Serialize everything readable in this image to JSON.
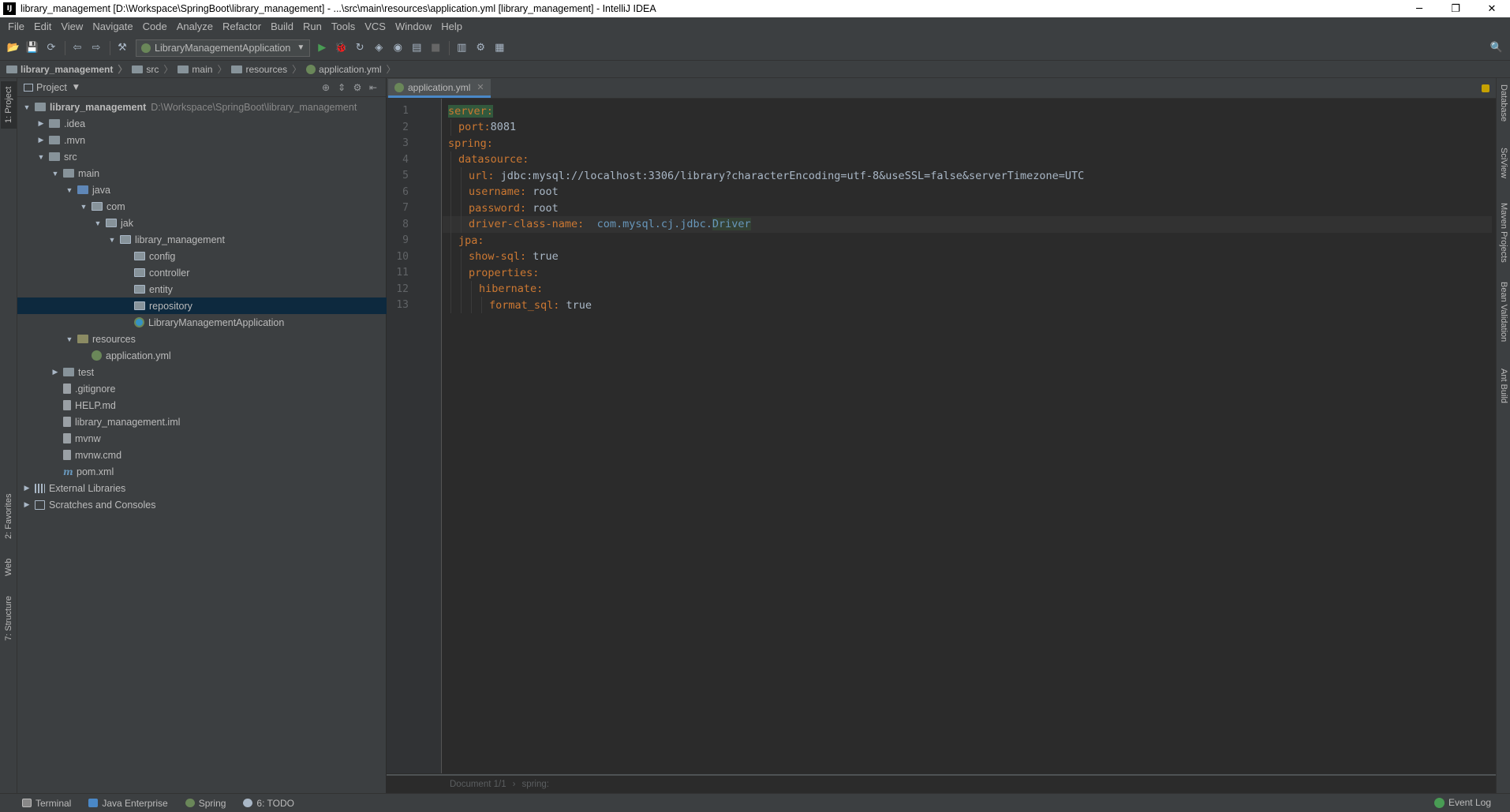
{
  "window": {
    "title": "library_management [D:\\Workspace\\SpringBoot\\library_management] - ...\\src\\main\\resources\\application.yml [library_management] - IntelliJ IDEA",
    "app_icon_text": "IJ",
    "minimize": "─",
    "restore": "❐",
    "close": "✕"
  },
  "menu": [
    "File",
    "Edit",
    "View",
    "Navigate",
    "Code",
    "Analyze",
    "Refactor",
    "Build",
    "Run",
    "Tools",
    "VCS",
    "Window",
    "Help"
  ],
  "toolbar": {
    "run_config": "LibraryManagementApplication",
    "icons": {
      "open": "📂",
      "save": "💾",
      "sync": "⟳",
      "back": "⇦",
      "forward": "⇨",
      "build": "⚒",
      "run": "▶",
      "debug": "🐞",
      "rerun": "↻",
      "coverage": "◈",
      "profile": "◉",
      "stop_all": "▤",
      "stop": "■",
      "structure": "▥",
      "sdk": "⚙",
      "project_structure": "▦",
      "search": "🔍"
    }
  },
  "breadcrumb": [
    "library_management",
    "src",
    "main",
    "resources",
    "application.yml"
  ],
  "left_tabs": {
    "project": "1: Project",
    "favorites": "2: Favorites",
    "web": "Web",
    "structure": "7: Structure"
  },
  "right_tabs": [
    "Database",
    "SciView",
    "Maven Projects",
    "Bean Validation",
    "Ant Build"
  ],
  "project_panel": {
    "title": "Project",
    "tree": [
      {
        "label": "library_management",
        "path": "D:\\Workspace\\SpringBoot\\library_management",
        "depth": 0,
        "arrow": "▼",
        "icon": "folder",
        "bold": true
      },
      {
        "label": ".idea",
        "depth": 1,
        "arrow": "▶",
        "icon": "folder"
      },
      {
        "label": ".mvn",
        "depth": 1,
        "arrow": "▶",
        "icon": "folder"
      },
      {
        "label": "src",
        "depth": 1,
        "arrow": "▼",
        "icon": "folder"
      },
      {
        "label": "main",
        "depth": 2,
        "arrow": "▼",
        "icon": "folder"
      },
      {
        "label": "java",
        "depth": 3,
        "arrow": "▼",
        "icon": "folder-src"
      },
      {
        "label": "com",
        "depth": 4,
        "arrow": "▼",
        "icon": "folder-pkg"
      },
      {
        "label": "jak",
        "depth": 5,
        "arrow": "▼",
        "icon": "folder-pkg"
      },
      {
        "label": "library_management",
        "depth": 6,
        "arrow": "▼",
        "icon": "folder-pkg"
      },
      {
        "label": "config",
        "depth": 7,
        "arrow": "",
        "icon": "folder-pkg"
      },
      {
        "label": "controller",
        "depth": 7,
        "arrow": "",
        "icon": "folder-pkg"
      },
      {
        "label": "entity",
        "depth": 7,
        "arrow": "",
        "icon": "folder-pkg"
      },
      {
        "label": "repository",
        "depth": 7,
        "arrow": "",
        "icon": "folder-pkg",
        "selected": true
      },
      {
        "label": "LibraryManagementApplication",
        "depth": 7,
        "arrow": "",
        "icon": "classico"
      },
      {
        "label": "resources",
        "depth": 3,
        "arrow": "▼",
        "icon": "folder-res"
      },
      {
        "label": "application.yml",
        "depth": 4,
        "arrow": "",
        "icon": "spring"
      },
      {
        "label": "test",
        "depth": 2,
        "arrow": "▶",
        "icon": "folder"
      },
      {
        "label": ".gitignore",
        "depth": 2,
        "arrow": "",
        "icon": "file"
      },
      {
        "label": "HELP.md",
        "depth": 2,
        "arrow": "",
        "icon": "file"
      },
      {
        "label": "library_management.iml",
        "depth": 2,
        "arrow": "",
        "icon": "file"
      },
      {
        "label": "mvnw",
        "depth": 2,
        "arrow": "",
        "icon": "file"
      },
      {
        "label": "mvnw.cmd",
        "depth": 2,
        "arrow": "",
        "icon": "file"
      },
      {
        "label": "pom.xml",
        "depth": 2,
        "arrow": "",
        "icon": "maven"
      },
      {
        "label": "External Libraries",
        "depth": 0,
        "arrow": "▶",
        "icon": "libs"
      },
      {
        "label": "Scratches and Consoles",
        "depth": 0,
        "arrow": "▶",
        "icon": "scratch"
      }
    ]
  },
  "editor": {
    "tab_label": "application.yml",
    "lines": [
      {
        "n": "1",
        "indent": 0,
        "key": "server:",
        "value": ""
      },
      {
        "n": "2",
        "indent": 1,
        "key": "port:",
        "value": "8081"
      },
      {
        "n": "3",
        "indent": 0,
        "key": "spring:",
        "value": ""
      },
      {
        "n": "4",
        "indent": 1,
        "key": "datasource:",
        "value": ""
      },
      {
        "n": "5",
        "indent": 2,
        "key": "url:",
        "value": " jdbc:mysql://localhost:3306/library?characterEncoding=utf-8&useSSL=false&serverTimezone=UTC"
      },
      {
        "n": "6",
        "indent": 2,
        "key": "username:",
        "value": " root"
      },
      {
        "n": "7",
        "indent": 2,
        "key": "password:",
        "value": " root"
      },
      {
        "n": "8",
        "indent": 2,
        "key": "driver-class-name:",
        "value": "  com.mysql.cj.jdbc.",
        "value_hl": "Driver"
      },
      {
        "n": "9",
        "indent": 1,
        "key": "jpa:",
        "value": ""
      },
      {
        "n": "10",
        "indent": 2,
        "key": "show-sql:",
        "value": " true"
      },
      {
        "n": "11",
        "indent": 2,
        "key": "properties:",
        "value": ""
      },
      {
        "n": "12",
        "indent": 3,
        "key": "hibernate:",
        "value": ""
      },
      {
        "n": "13",
        "indent": 4,
        "key": "format_sql:",
        "value": " true"
      }
    ],
    "status_breadcrumb": [
      "Document 1/1",
      "spring:"
    ]
  },
  "bottom_tools": [
    "Terminal",
    "Java Enterprise",
    "Spring",
    "6: TODO"
  ],
  "event_log": "Event Log"
}
